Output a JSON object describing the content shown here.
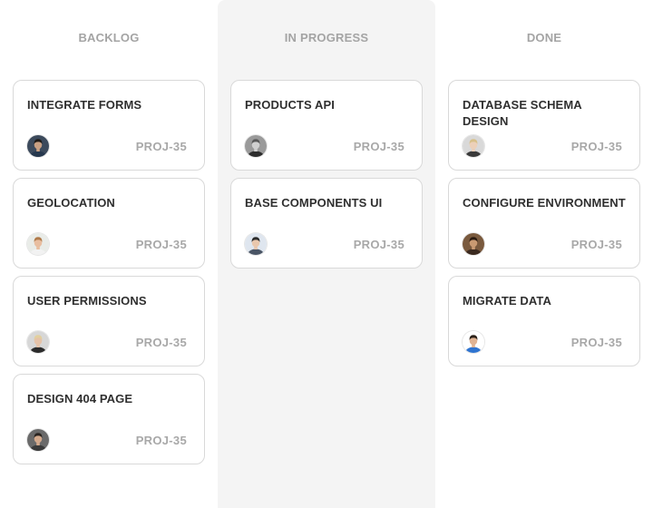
{
  "board": {
    "columns": [
      {
        "name": "BACKLOG",
        "cards": [
          {
            "title": "INTEGRATE FORMS",
            "id": "PROJ-35",
            "avatar": {
              "bg": "#3c4a5c",
              "skin": "#c9a083",
              "hair": "#1f1b18",
              "shirt": "#26384e"
            }
          },
          {
            "title": "GEOLOCATION",
            "id": "PROJ-35",
            "avatar": {
              "bg": "#e9ece8",
              "skin": "#e8bea0",
              "hair": "#b07a4a",
              "shirt": "#f2f2f2"
            }
          },
          {
            "title": "USER PERMISSIONS",
            "id": "PROJ-35",
            "avatar": {
              "bg": "#d7d7d7",
              "skin": "#e5c2a8",
              "hair": "#e2cf9e",
              "shirt": "#2b2b2b"
            }
          },
          {
            "title": "DESIGN 404 PAGE",
            "id": "PROJ-35",
            "avatar": {
              "bg": "#6a6a6a",
              "skin": "#d3a98c",
              "hair": "#2a2420",
              "shirt": "#3a3a3a"
            }
          }
        ]
      },
      {
        "name": "IN PROGRESS",
        "cards": [
          {
            "title": "PRODUCTS API",
            "id": "PROJ-35",
            "avatar": {
              "bg": "#9a9a9a",
              "skin": "#d0d0d0",
              "hair": "#5a5a5a",
              "shirt": "#2d2d2d"
            }
          },
          {
            "title": "BASE COMPONENTS UI",
            "id": "PROJ-35",
            "avatar": {
              "bg": "#dfe6ef",
              "skin": "#e9c7ad",
              "hair": "#2b2b2b",
              "shirt": "#4a5565"
            }
          }
        ]
      },
      {
        "name": "DONE",
        "cards": [
          {
            "title": "DATABASE SCHEMA DESIGN",
            "id": "PROJ-35",
            "avatar": {
              "bg": "#d9d9d9",
              "skin": "#ecd0b9",
              "hair": "#d8c08a",
              "shirt": "#3a3a3a"
            }
          },
          {
            "title": "CONFIGURE ENVIRONMENT",
            "id": "PROJ-35",
            "avatar": {
              "bg": "#7a5a3e",
              "skin": "#c99a72",
              "hair": "#2a1a10",
              "shirt": "#3b2a20"
            }
          },
          {
            "title": "MIGRATE DATA",
            "id": "PROJ-35",
            "avatar": {
              "bg": "#ffffff",
              "skin": "#e0b393",
              "hair": "#2b2018",
              "shirt": "#2f74d0"
            }
          }
        ]
      }
    ],
    "active_column": "IN PROGRESS"
  },
  "colors": {
    "active_column_bg": "#f4f4f4",
    "header_text": "#a4a4a4",
    "card_border": "#d9d9d9",
    "title_text": "#2f2f2f",
    "id_text": "#a8a8a8"
  }
}
